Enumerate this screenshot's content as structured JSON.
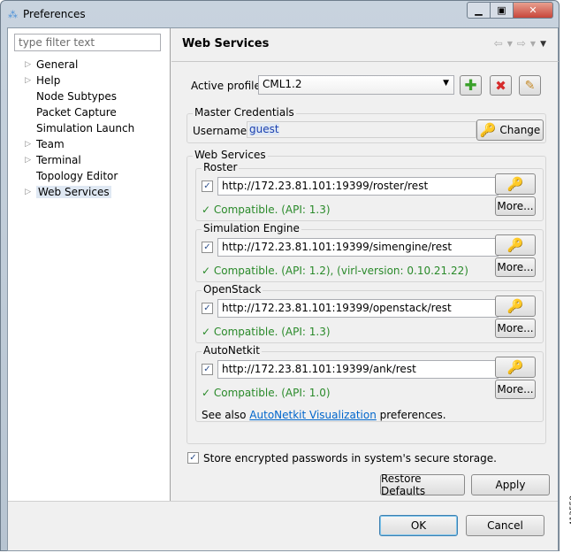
{
  "window": {
    "title": "Preferences",
    "minimize_icon": "minimize-icon",
    "maximize_icon": "maximize-icon",
    "close_icon": "close-icon"
  },
  "sidebar": {
    "filter_placeholder": "type filter text",
    "items": [
      {
        "label": "General",
        "expandable": true
      },
      {
        "label": "Help",
        "expandable": true
      },
      {
        "label": "Node Subtypes",
        "expandable": false
      },
      {
        "label": "Packet Capture",
        "expandable": false
      },
      {
        "label": "Simulation Launch",
        "expandable": false
      },
      {
        "label": "Team",
        "expandable": true
      },
      {
        "label": "Terminal",
        "expandable": true
      },
      {
        "label": "Topology Editor",
        "expandable": false
      },
      {
        "label": "Web Services",
        "expandable": true,
        "selected": true
      }
    ]
  },
  "page": {
    "title": "Web Services",
    "active_profile_label": "Active profile:",
    "active_profile_value": "CML1.2",
    "master_credentials": {
      "title": "Master Credentials",
      "username_label": "Username:",
      "username_value": "guest",
      "change_label": "Change"
    },
    "web_services_title": "Web Services",
    "services": [
      {
        "name": "Roster",
        "url": "http://172.23.81.101:19399/roster/rest",
        "status": "✓ Compatible. (API: 1.3)",
        "more": "More..."
      },
      {
        "name": "Simulation Engine",
        "url": "http://172.23.81.101:19399/simengine/rest",
        "status": "✓ Compatible. (API: 1.2), (virl-version: 0.10.21.22)",
        "more": "More..."
      },
      {
        "name": "OpenStack",
        "url": "http://172.23.81.101:19399/openstack/rest",
        "status": "✓ Compatible. (API: 1.3)",
        "more": "More..."
      },
      {
        "name": "AutoNetkit",
        "url": "http://172.23.81.101:19399/ank/rest",
        "status": "✓ Compatible. (API: 1.0)",
        "more": "More..."
      }
    ],
    "see_also_prefix": "See also ",
    "see_also_link": "AutoNetkit Visualization",
    "see_also_suffix": " preferences.",
    "store_passwords_label": "Store encrypted passwords in system's secure storage.",
    "restore_defaults": "Restore Defaults",
    "apply": "Apply"
  },
  "footer": {
    "ok": "OK",
    "cancel": "Cancel"
  },
  "figure_id": "413558",
  "colors": {
    "status_green": "#2a8a2a",
    "link_blue": "#0066cc"
  }
}
